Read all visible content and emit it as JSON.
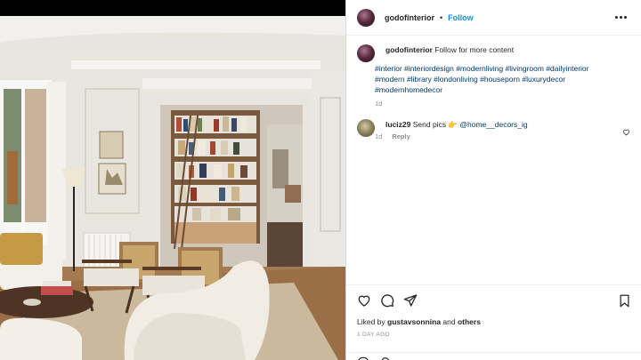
{
  "post": {
    "image_alt": "Parisian living room with built-in library bookshelves",
    "author": "godofinterior",
    "header": {
      "username": "godofinterior",
      "separator": "•",
      "follow_label": "Follow"
    },
    "caption": {
      "username": "godofinterior",
      "text": "Follow for more content",
      "hashtags": "#interior #interiordesign #modernliving #livingroom #dailyinterior #modern #library #londonliving #houseporn #luxurydecor #modernhomedecor",
      "age": "1d"
    },
    "comments": [
      {
        "username": "luciz29",
        "text": "Send pics 👉",
        "mention": "@home__decors_ig",
        "age": "1d",
        "reply_label": "Reply"
      }
    ],
    "likes": {
      "prefix": "Liked by",
      "first_user": "gustavsonnina",
      "joiner": "and",
      "others": "others"
    },
    "date": "1 DAY AGO"
  },
  "icons": {
    "more": "more-options-icon",
    "like": "heart-icon",
    "comment": "comment-bubble-icon",
    "share": "paper-plane-icon",
    "save": "bookmark-icon",
    "comment_like": "small-heart-icon"
  },
  "colors": {
    "follow": "#0095f6",
    "hashtag": "#00376b",
    "muted": "#8e8e8e",
    "text": "#262626"
  }
}
